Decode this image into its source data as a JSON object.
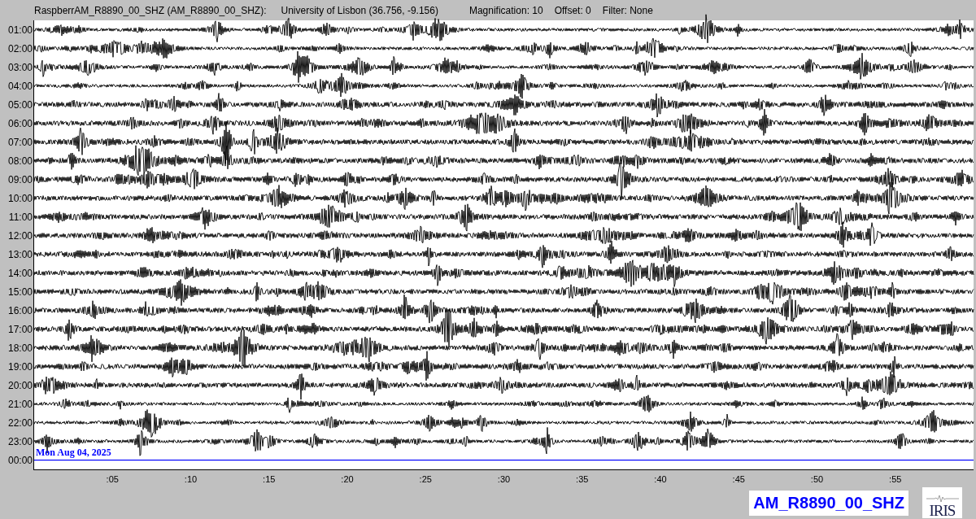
{
  "header": {
    "title": "RaspberrAM_R8890_00_SHZ (AM_R8890_00_SHZ):",
    "location": "University of Lisbon (36.756, -9.156)",
    "magnification": "Magnification: 10",
    "offset": "Offset: 0",
    "filter": "Filter: None"
  },
  "rows": [
    {
      "label": "01:00",
      "kind": "trace"
    },
    {
      "label": "02:00",
      "kind": "trace"
    },
    {
      "label": "03:00",
      "kind": "trace"
    },
    {
      "label": "04:00",
      "kind": "trace"
    },
    {
      "label": "05:00",
      "kind": "trace"
    },
    {
      "label": "06:00",
      "kind": "trace"
    },
    {
      "label": "07:00",
      "kind": "trace"
    },
    {
      "label": "08:00",
      "kind": "trace"
    },
    {
      "label": "09:00",
      "kind": "trace"
    },
    {
      "label": "10:00",
      "kind": "trace"
    },
    {
      "label": "11:00",
      "kind": "trace"
    },
    {
      "label": "12:00",
      "kind": "trace"
    },
    {
      "label": "13:00",
      "kind": "trace"
    },
    {
      "label": "14:00",
      "kind": "trace"
    },
    {
      "label": "15:00",
      "kind": "trace"
    },
    {
      "label": "16:00",
      "kind": "trace"
    },
    {
      "label": "17:00",
      "kind": "trace"
    },
    {
      "label": "18:00",
      "kind": "trace"
    },
    {
      "label": "19:00",
      "kind": "trace"
    },
    {
      "label": "20:00",
      "kind": "trace"
    },
    {
      "label": "21:00",
      "kind": "trace"
    },
    {
      "label": "22:00",
      "kind": "trace"
    },
    {
      "label": "23:00",
      "kind": "trace"
    },
    {
      "label": "00:00",
      "kind": "current",
      "date": "Mon Aug 04, 2025"
    }
  ],
  "x_ticks": [
    ":05",
    ":10",
    ":15",
    ":20",
    ":25",
    ":30",
    ":35",
    ":40",
    ":45",
    ":50",
    ":55"
  ],
  "station_label": "AM_R8890_00_SHZ",
  "logo": {
    "text": "IRIS"
  }
}
